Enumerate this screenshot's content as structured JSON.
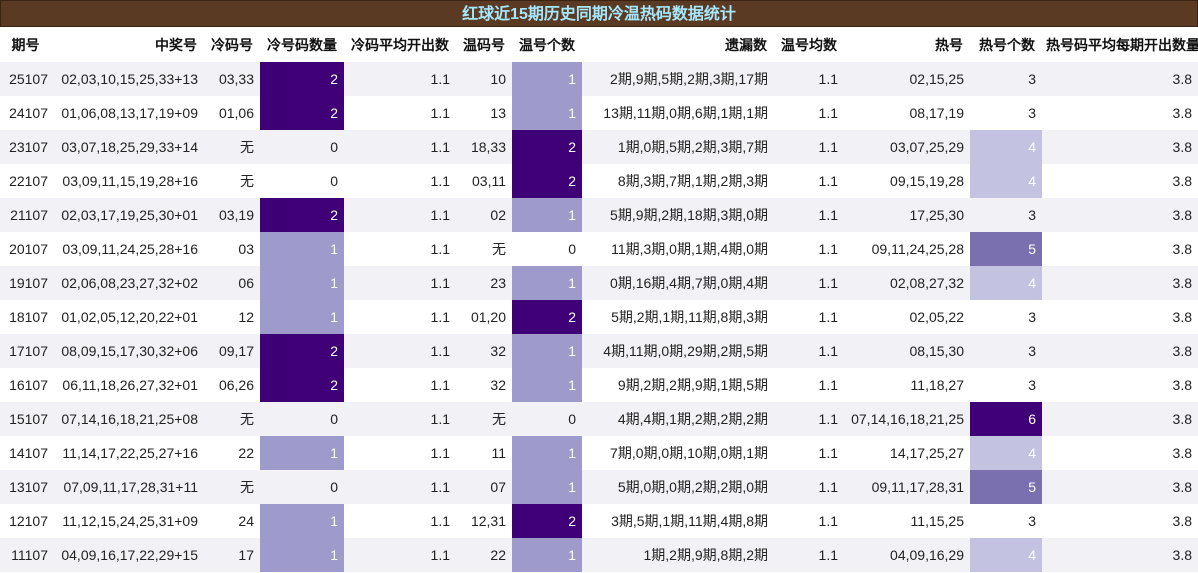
{
  "title": "红球近15期历史同期冷温热码数据统计",
  "headers": [
    "期号",
    "中奖号",
    "冷码号",
    "冷号码数量",
    "冷码平均开出数",
    "温码号",
    "温号个数",
    "遗漏数",
    "温号均数",
    "热号",
    "热号个数",
    "热号码平均每期开出数量"
  ],
  "colors": {
    "title_bg": "#5a3a22",
    "title_text": "#a6e8ff",
    "scale_1": "#c3c2e0",
    "scale_2": "#9e9acb",
    "scale_3": "#7a70b0",
    "scale_4": "#3f0077"
  },
  "rows": [
    {
      "issue": "25107",
      "numbers": "02,03,10,15,25,33+13",
      "cold": "03,33",
      "cold_count": "2",
      "cold_avg": "1.1",
      "warm": "10",
      "warm_count": "1",
      "miss": "2期,9期,5期,2期,3期,17期",
      "warm_avg": "1.1",
      "hot": "02,15,25",
      "hot_count": "3",
      "hot_avg": "3.8"
    },
    {
      "issue": "24107",
      "numbers": "01,06,08,13,17,19+09",
      "cold": "01,06",
      "cold_count": "2",
      "cold_avg": "1.1",
      "warm": "13",
      "warm_count": "1",
      "miss": "13期,11期,0期,6期,1期,1期",
      "warm_avg": "1.1",
      "hot": "08,17,19",
      "hot_count": "3",
      "hot_avg": "3.8"
    },
    {
      "issue": "23107",
      "numbers": "03,07,18,25,29,33+14",
      "cold": "无",
      "cold_count": "0",
      "cold_avg": "1.1",
      "warm": "18,33",
      "warm_count": "2",
      "miss": "1期,0期,5期,2期,3期,7期",
      "warm_avg": "1.1",
      "hot": "03,07,25,29",
      "hot_count": "4",
      "hot_avg": "3.8"
    },
    {
      "issue": "22107",
      "numbers": "03,09,11,15,19,28+16",
      "cold": "无",
      "cold_count": "0",
      "cold_avg": "1.1",
      "warm": "03,11",
      "warm_count": "2",
      "miss": "8期,3期,7期,1期,2期,3期",
      "warm_avg": "1.1",
      "hot": "09,15,19,28",
      "hot_count": "4",
      "hot_avg": "3.8"
    },
    {
      "issue": "21107",
      "numbers": "02,03,17,19,25,30+01",
      "cold": "03,19",
      "cold_count": "2",
      "cold_avg": "1.1",
      "warm": "02",
      "warm_count": "1",
      "miss": "5期,9期,2期,18期,3期,0期",
      "warm_avg": "1.1",
      "hot": "17,25,30",
      "hot_count": "3",
      "hot_avg": "3.8"
    },
    {
      "issue": "20107",
      "numbers": "03,09,11,24,25,28+16",
      "cold": "03",
      "cold_count": "1",
      "cold_avg": "1.1",
      "warm": "无",
      "warm_count": "0",
      "miss": "11期,3期,0期,1期,4期,0期",
      "warm_avg": "1.1",
      "hot": "09,11,24,25,28",
      "hot_count": "5",
      "hot_avg": "3.8"
    },
    {
      "issue": "19107",
      "numbers": "02,06,08,23,27,32+02",
      "cold": "06",
      "cold_count": "1",
      "cold_avg": "1.1",
      "warm": "23",
      "warm_count": "1",
      "miss": "0期,16期,4期,7期,0期,4期",
      "warm_avg": "1.1",
      "hot": "02,08,27,32",
      "hot_count": "4",
      "hot_avg": "3.8"
    },
    {
      "issue": "18107",
      "numbers": "01,02,05,12,20,22+01",
      "cold": "12",
      "cold_count": "1",
      "cold_avg": "1.1",
      "warm": "01,20",
      "warm_count": "2",
      "miss": "5期,2期,1期,11期,8期,3期",
      "warm_avg": "1.1",
      "hot": "02,05,22",
      "hot_count": "3",
      "hot_avg": "3.8"
    },
    {
      "issue": "17107",
      "numbers": "08,09,15,17,30,32+06",
      "cold": "09,17",
      "cold_count": "2",
      "cold_avg": "1.1",
      "warm": "32",
      "warm_count": "1",
      "miss": "4期,11期,0期,29期,2期,5期",
      "warm_avg": "1.1",
      "hot": "08,15,30",
      "hot_count": "3",
      "hot_avg": "3.8"
    },
    {
      "issue": "16107",
      "numbers": "06,11,18,26,27,32+01",
      "cold": "06,26",
      "cold_count": "2",
      "cold_avg": "1.1",
      "warm": "32",
      "warm_count": "1",
      "miss": "9期,2期,2期,9期,1期,5期",
      "warm_avg": "1.1",
      "hot": "11,18,27",
      "hot_count": "3",
      "hot_avg": "3.8"
    },
    {
      "issue": "15107",
      "numbers": "07,14,16,18,21,25+08",
      "cold": "无",
      "cold_count": "0",
      "cold_avg": "1.1",
      "warm": "无",
      "warm_count": "0",
      "miss": "4期,4期,1期,2期,2期,2期",
      "warm_avg": "1.1",
      "hot": "07,14,16,18,21,25",
      "hot_count": "6",
      "hot_avg": "3.8"
    },
    {
      "issue": "14107",
      "numbers": "11,14,17,22,25,27+16",
      "cold": "22",
      "cold_count": "1",
      "cold_avg": "1.1",
      "warm": "11",
      "warm_count": "1",
      "miss": "7期,0期,0期,10期,0期,1期",
      "warm_avg": "1.1",
      "hot": "14,17,25,27",
      "hot_count": "4",
      "hot_avg": "3.8"
    },
    {
      "issue": "13107",
      "numbers": "07,09,11,17,28,31+11",
      "cold": "无",
      "cold_count": "0",
      "cold_avg": "1.1",
      "warm": "07",
      "warm_count": "1",
      "miss": "5期,0期,0期,2期,2期,0期",
      "warm_avg": "1.1",
      "hot": "09,11,17,28,31",
      "hot_count": "5",
      "hot_avg": "3.8"
    },
    {
      "issue": "12107",
      "numbers": "11,12,15,24,25,31+09",
      "cold": "24",
      "cold_count": "1",
      "cold_avg": "1.1",
      "warm": "12,31",
      "warm_count": "2",
      "miss": "3期,5期,1期,11期,4期,8期",
      "warm_avg": "1.1",
      "hot": "11,15,25",
      "hot_count": "3",
      "hot_avg": "3.8"
    },
    {
      "issue": "11107",
      "numbers": "04,09,16,17,22,29+15",
      "cold": "17",
      "cold_count": "1",
      "cold_avg": "1.1",
      "warm": "22",
      "warm_count": "1",
      "miss": "1期,2期,9期,8期,2期",
      "warm_avg": "1.1",
      "hot": "04,09,16,29",
      "hot_count": "4",
      "hot_avg": "3.8"
    }
  ]
}
